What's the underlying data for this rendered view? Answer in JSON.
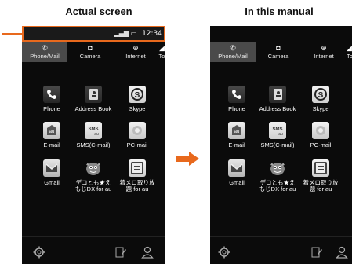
{
  "captions": {
    "actual": "Actual screen",
    "manual": "In this manual"
  },
  "statusbar": {
    "time": "12:34"
  },
  "tabs": [
    {
      "label": "Phone/Mail",
      "icon": "phone-icon"
    },
    {
      "label": "Camera",
      "icon": "camera-icon"
    },
    {
      "label": "Internet",
      "icon": "globe-icon"
    },
    {
      "label": "To",
      "icon": "tools-icon"
    }
  ],
  "apps": [
    {
      "label": "Phone",
      "icon": "phone-icon"
    },
    {
      "label": "Address Book",
      "icon": "address-book-icon"
    },
    {
      "label": "Skype",
      "icon": "skype-icon"
    },
    {
      "label": "E-mail",
      "icon": "email-icon"
    },
    {
      "label": "SMS(C-mail)",
      "icon": "sms-icon"
    },
    {
      "label": "PC-mail",
      "icon": "pc-mail-icon"
    },
    {
      "label": "Gmail",
      "icon": "gmail-icon"
    },
    {
      "label": "デコとも★え\nもじDX for au",
      "icon": "deco-icon"
    },
    {
      "label": "着メロ取り放\n題 for au",
      "icon": "melody-icon"
    }
  ],
  "bottombar": {
    "icons": [
      "settings-icon",
      "edit-icon",
      "person-icon"
    ]
  },
  "colors": {
    "accent": "#e8691d",
    "screen_bg": "#0b0b0b"
  }
}
